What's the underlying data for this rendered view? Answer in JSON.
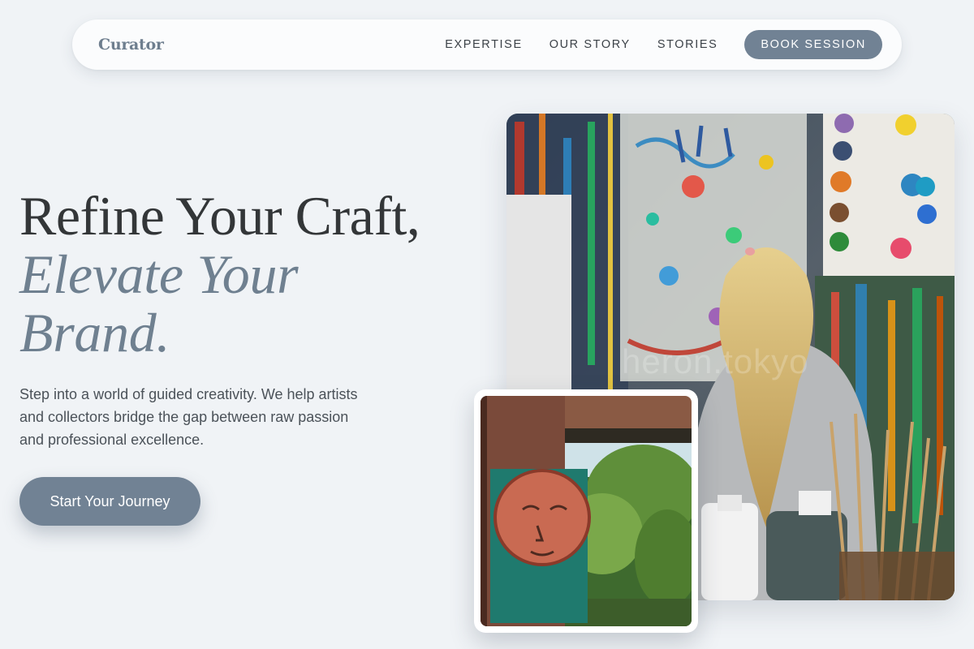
{
  "nav": {
    "brand": "Curator",
    "links": [
      "EXPERTISE",
      "OUR STORY",
      "STORIES"
    ],
    "cta_label": "BOOK SESSION"
  },
  "hero": {
    "headline_line1": "Refine Your Craft,",
    "headline_line2": "Elevate Your",
    "headline_line3": "Brand.",
    "lede": "Step into a world of guided creativity. We help artists and collectors bridge the gap between raw passion and professional excellence.",
    "cta_label": "Start Your Journey"
  },
  "images": {
    "main_watermark": "heron.tokyo",
    "main_icon": "painter-at-wall-photo",
    "inset_icon": "sculpture-garden-photo"
  },
  "colors": {
    "background": "#f0f3f6",
    "accent": "#718294",
    "headline_dark": "#333638",
    "headline_accent": "#6f8090"
  }
}
